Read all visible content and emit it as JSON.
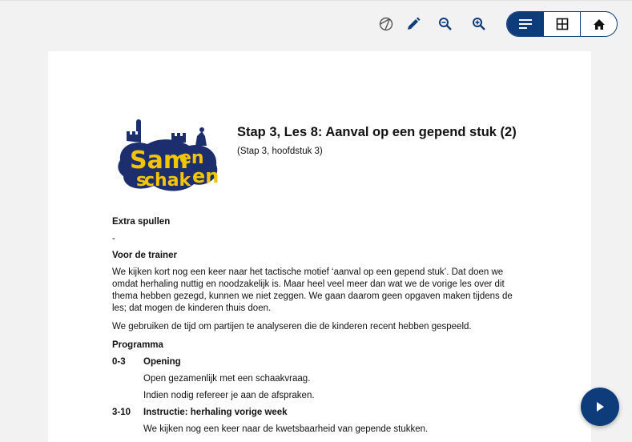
{
  "toolbar": {
    "icons": [
      "eraser-icon",
      "pencil-icon",
      "zoom-out-icon",
      "zoom-in-icon"
    ],
    "view_modes": [
      "list-view-icon",
      "grid-view-icon",
      "home-icon"
    ],
    "active_view": "list-view-icon",
    "accent_color": "#0e3b7a"
  },
  "document": {
    "logo_text": "Samen schaken",
    "title": "Stap 3, Les 8: Aanval op een gepend stuk (2)",
    "subtitle": "(Stap 3, hoofdstuk 3)",
    "extra_heading": "Extra spullen",
    "extra_value": "-",
    "trainer_heading": "Voor de trainer",
    "trainer_p1": "We kijken kort nog een keer naar het tactische motief ‘aanval op een gepend stuk’. Dat doen we omdat herhaling nuttig en noodzakelijk is. Maar heel veel meer dan wat we de vorige les over dit thema hebben gezegd, kunnen we niet zeggen. We gaan daarom geen opgaven maken tijdens de les; dat mogen de kinderen thuis doen.",
    "trainer_p2": "We gebruiken de tijd om partijen te analyseren die de kinderen recent hebben gespeeld.",
    "program_heading": "Programma",
    "program": [
      {
        "time": "0-3",
        "label": "Opening",
        "lines": [
          "Open gezamenlijk met een schaakvraag.",
          "Indien nodig refereer je aan de afspraken."
        ]
      },
      {
        "time": "3-10",
        "label": "Instructie: herhaling vorige week",
        "lines": [
          "We kijken nog een keer naar de kwetsbaarheid van gepende stukken."
        ]
      }
    ]
  },
  "fab": {
    "icon": "play-icon"
  }
}
